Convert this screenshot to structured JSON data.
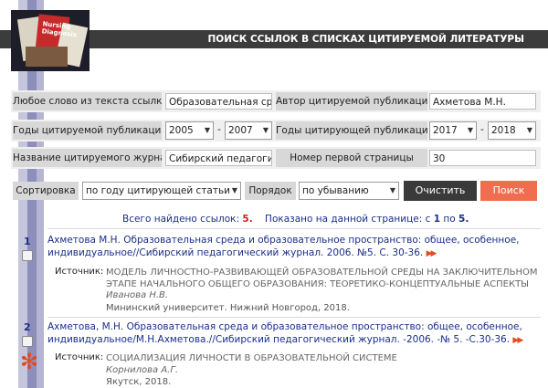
{
  "header": {
    "title": "ПОИСК ССЫЛОК В СПИСКАХ ЦИТИРУЕМОЙ ЛИТЕРАТУРЫ",
    "logo_text": "Nursing Diagnosis"
  },
  "form": {
    "word_label": "Любое слово из текста ссылки",
    "word_value": "Образовательная среда",
    "author_label": "Автор цитируемой публикации",
    "author_value": "Ахметова М.Н.",
    "cited_years_label": "Годы цитируемой публикации",
    "cited_year_from": "2005",
    "cited_year_to": "2007",
    "citing_years_label": "Годы цитирующей публикации",
    "citing_year_from": "2017",
    "citing_year_to": "2018",
    "dash": "-",
    "journal_label": "Название цитируемого журнала",
    "journal_value": "Сибирский педагогический",
    "first_page_label": "Номер первой страницы",
    "first_page_value": "30",
    "sort_label": "Сортировка",
    "sort_value": "по году цитирующей статьи",
    "order_label": "Порядок",
    "order_value": "по убыванию",
    "clear_label": "Очистить",
    "search_label": "Поиск"
  },
  "summary": {
    "found_prefix": "Всего найдено ссылок:",
    "found_count": "5.",
    "shown_prefix": "Показано на данной странице: с",
    "shown_from": "1",
    "shown_mid": "по",
    "shown_to": "5."
  },
  "results": [
    {
      "num": "1",
      "title_line1": "Ахметова М.Н. Образовательная среда и образовательное пространство: общее, особенное,",
      "title_line2": "индивидуальное//Сибирский педагогический журнал. 2006. №5. С. 30-36.",
      "source_label": "Источник:",
      "source_title_line1": "МОДЕЛЬ ЛИЧНОСТНО-РАЗВИВАЮЩЕЙ ОБРАЗОВАТЕЛЬНОЙ СРЕДЫ НА ЗАКЛЮЧИТЕЛЬНОМ",
      "source_title_line2": "ЭТАПЕ НАЧАЛЬНОГО ОБЩЕГО ОБРАЗОВАНИЯ: ТЕОРЕТИКО-КОНЦЕПТУАЛЬНЫЕ АСПЕКТЫ",
      "source_author": "Иванова Н.В.",
      "source_pub": "Мининский университет. Нижний Новгород, 2018."
    },
    {
      "num": "2",
      "title_line1": "Ахметова, М.Н. Образовательная среда и образовательное пространство: общее, особенное,",
      "title_line2": "индивидуальное/М.Н.Ахметова.//Сибирский педагогический журнал. -2006. -№ 5. -С.30-36.",
      "source_label": "Источник:",
      "source_title_line1": "СОЦИАЛИЗАЦИЯ ЛИЧНОСТИ В ОБРАЗОВАТЕЛЬНОЙ СИСТЕМЕ",
      "source_author": "Корнилова А.Г.",
      "source_pub": "Якутск, 2018."
    }
  ],
  "colors": {
    "accent": "#f06d50",
    "link": "#1a2f88",
    "count": "#d21f1f"
  }
}
